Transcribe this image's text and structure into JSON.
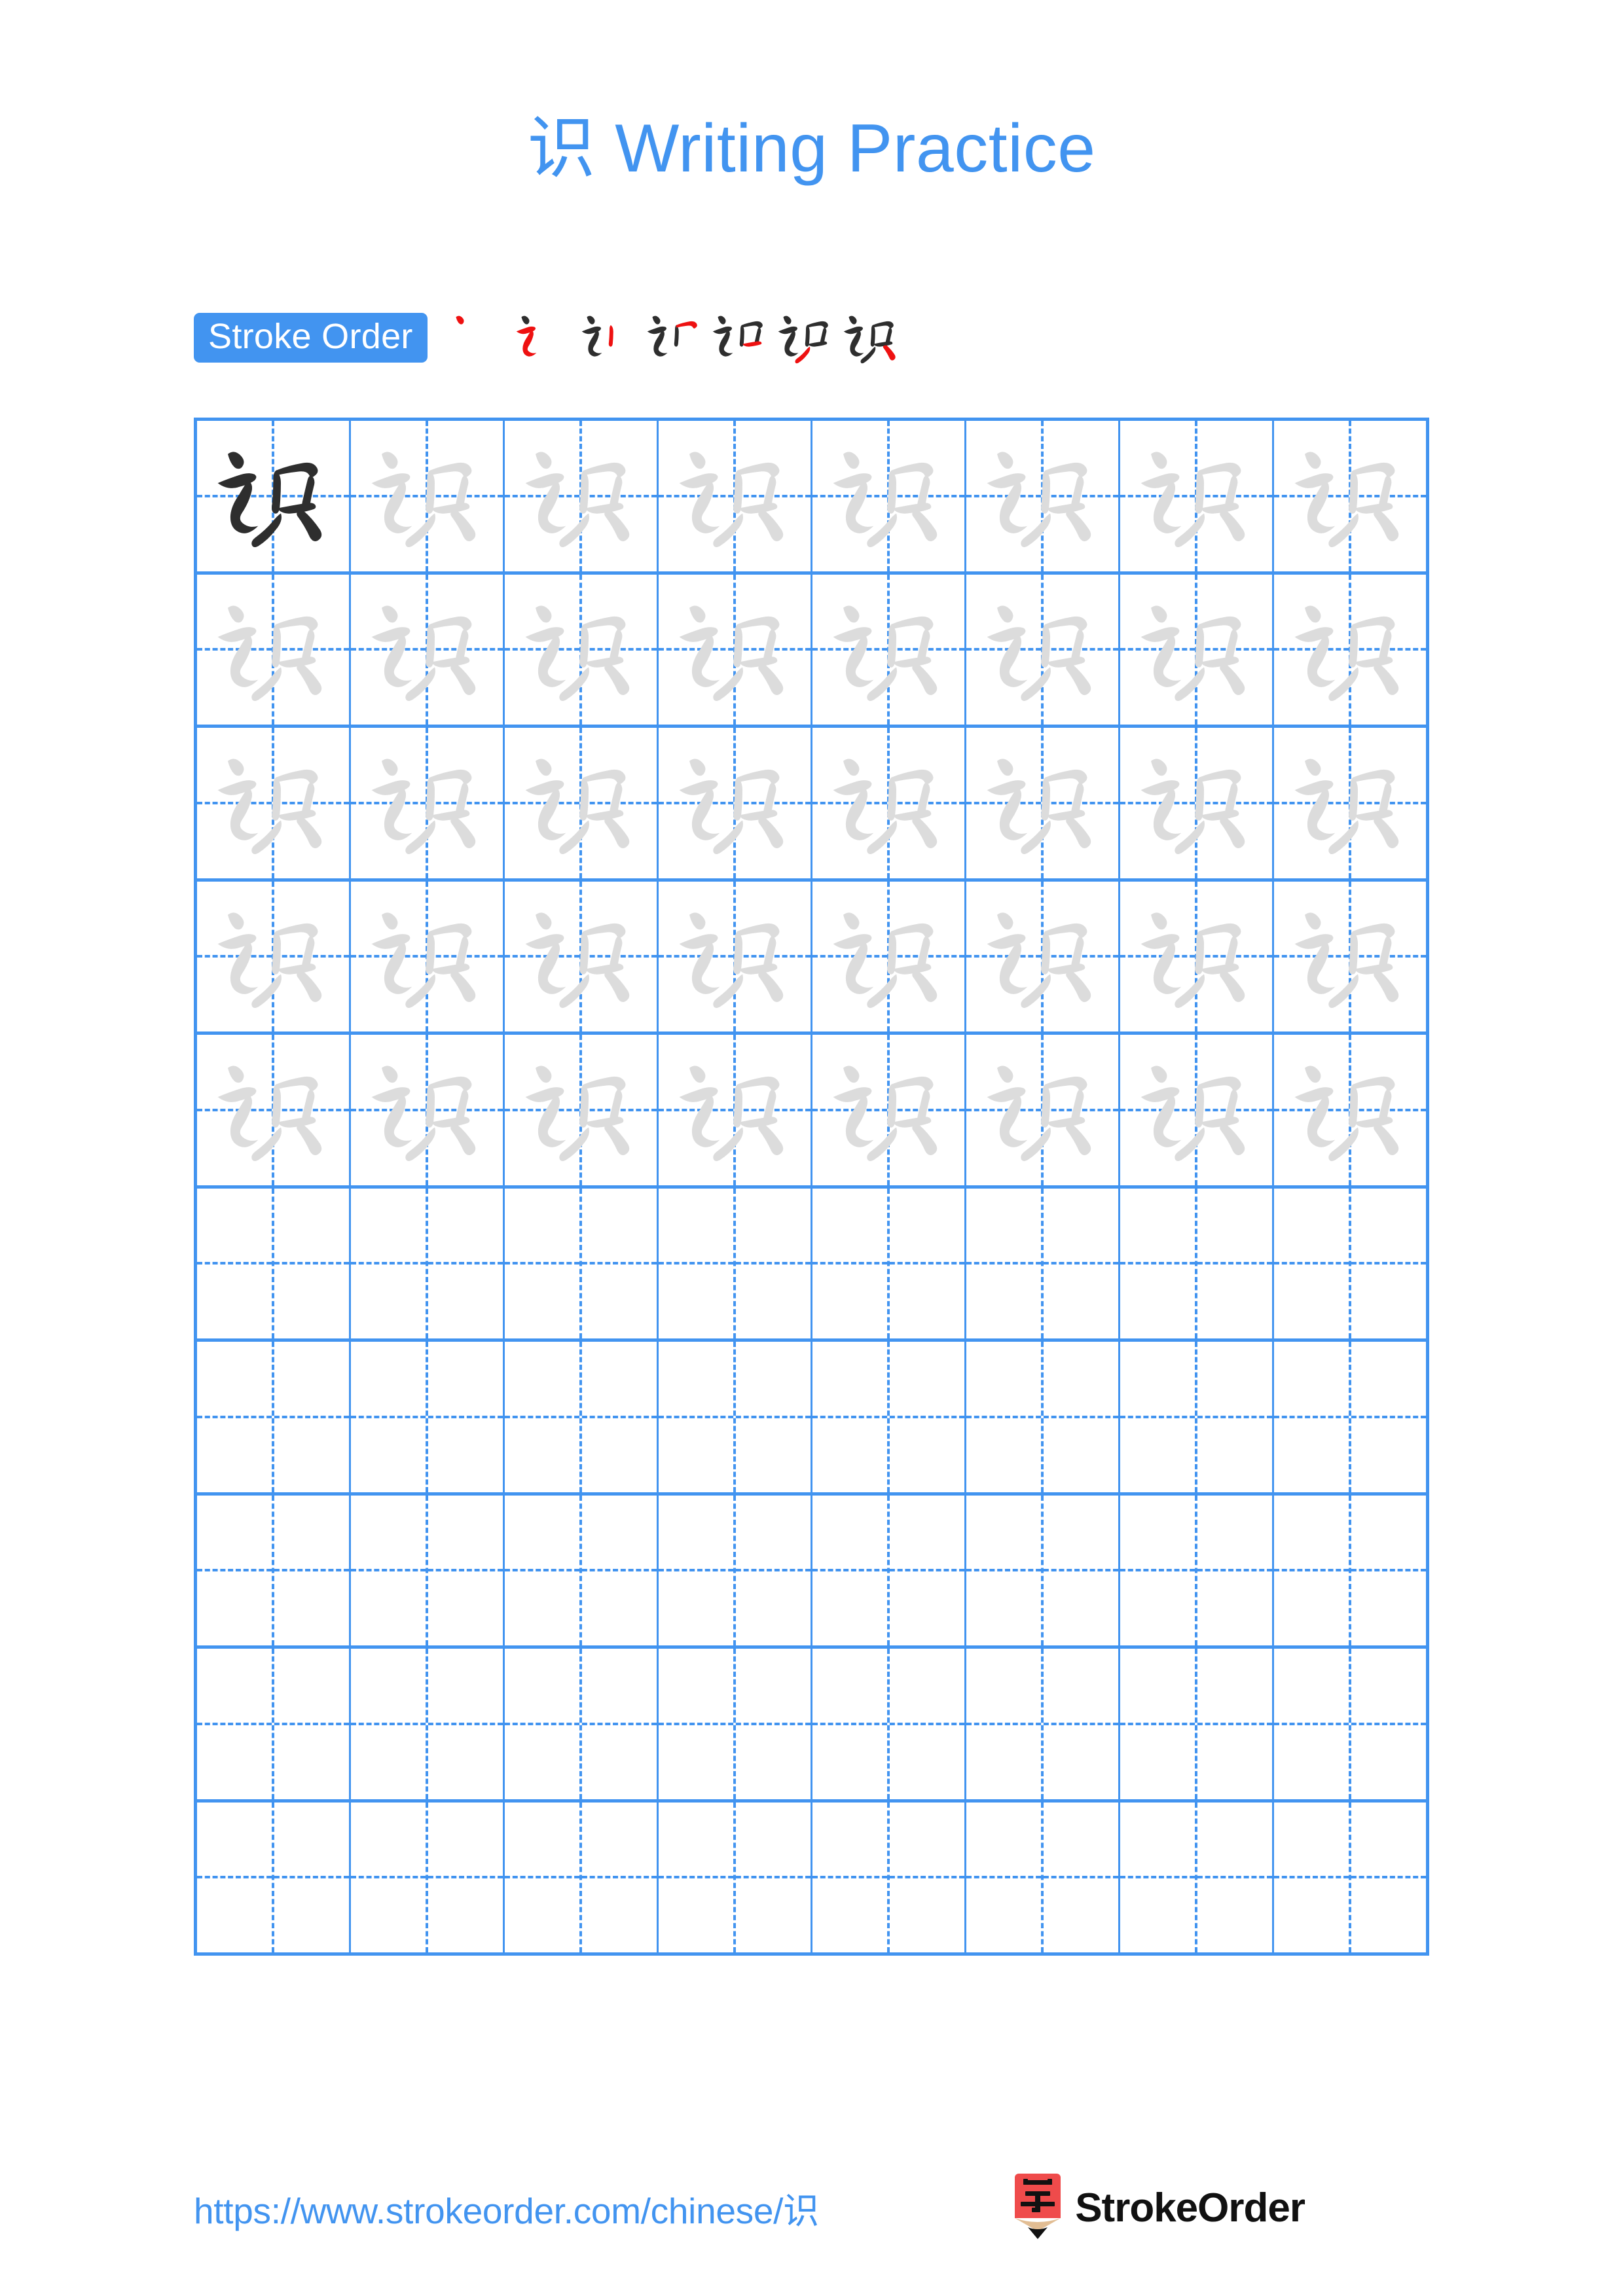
{
  "page": {
    "character": "识",
    "title": "识 Writing Practice",
    "title_suffix": " Writing Practice",
    "background_color": "#ffffff",
    "accent_color": "#4294f0",
    "trace_color": "#dcdcdc",
    "ink_color": "#2e2e2e",
    "highlight_stroke_color": "#ee1111"
  },
  "stroke_order": {
    "label": "Stroke Order",
    "badge_color": "#4294f0",
    "badge_text_color": "#ffffff",
    "total_strokes": 7,
    "steps": [
      {
        "index": 1,
        "strokes_shown": 1,
        "new_stroke": 1,
        "name": "stroke-step-1"
      },
      {
        "index": 2,
        "strokes_shown": 2,
        "new_stroke": 2,
        "name": "stroke-step-2"
      },
      {
        "index": 3,
        "strokes_shown": 3,
        "new_stroke": 3,
        "name": "stroke-step-3"
      },
      {
        "index": 4,
        "strokes_shown": 4,
        "new_stroke": 4,
        "name": "stroke-step-4"
      },
      {
        "index": 5,
        "strokes_shown": 5,
        "new_stroke": 5,
        "name": "stroke-step-5"
      },
      {
        "index": 6,
        "strokes_shown": 6,
        "new_stroke": 6,
        "name": "stroke-step-6"
      },
      {
        "index": 7,
        "strokes_shown": 7,
        "new_stroke": 7,
        "name": "stroke-step-7"
      }
    ]
  },
  "grid": {
    "columns": 8,
    "rows": 10,
    "border_color": "#4294f0",
    "guide_line_style": "dashed",
    "cells": [
      [
        "solid",
        "trace",
        "trace",
        "trace",
        "trace",
        "trace",
        "trace",
        "trace"
      ],
      [
        "trace",
        "trace",
        "trace",
        "trace",
        "trace",
        "trace",
        "trace",
        "trace"
      ],
      [
        "trace",
        "trace",
        "trace",
        "trace",
        "trace",
        "trace",
        "trace",
        "trace"
      ],
      [
        "trace",
        "trace",
        "trace",
        "trace",
        "trace",
        "trace",
        "trace",
        "trace"
      ],
      [
        "trace",
        "trace",
        "trace",
        "trace",
        "trace",
        "trace",
        "trace",
        "trace"
      ],
      [
        "empty",
        "empty",
        "empty",
        "empty",
        "empty",
        "empty",
        "empty",
        "empty"
      ],
      [
        "empty",
        "empty",
        "empty",
        "empty",
        "empty",
        "empty",
        "empty",
        "empty"
      ],
      [
        "empty",
        "empty",
        "empty",
        "empty",
        "empty",
        "empty",
        "empty",
        "empty"
      ],
      [
        "empty",
        "empty",
        "empty",
        "empty",
        "empty",
        "empty",
        "empty",
        "empty"
      ],
      [
        "empty",
        "empty",
        "empty",
        "empty",
        "empty",
        "empty",
        "empty",
        "empty"
      ]
    ]
  },
  "footer": {
    "url": "https://www.strokeorder.com/chinese/识",
    "brand_name": "StrokeOrder",
    "logo_char": "字",
    "logo_body_color": "#ef4b4b",
    "logo_wood_color": "#e2bd93",
    "logo_tip_color": "#111111"
  }
}
